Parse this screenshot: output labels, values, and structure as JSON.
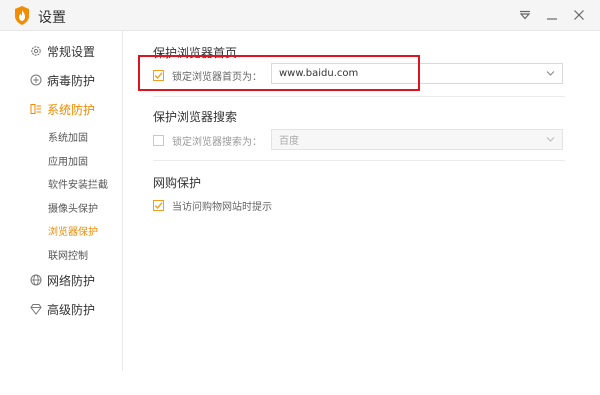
{
  "window": {
    "title": "设置",
    "icons": [
      "fire-shield-logo",
      "menu-dropdown-icon",
      "minimize-icon",
      "close-icon"
    ]
  },
  "sidebar": {
    "items": [
      {
        "label": "常规设置",
        "icon": "gear-icon"
      },
      {
        "label": "病毒防护",
        "icon": "plus-circle-icon"
      },
      {
        "label": "系统防护",
        "icon": "system-icon",
        "active": true
      },
      {
        "label": "网络防护",
        "icon": "globe-icon"
      },
      {
        "label": "高级防护",
        "icon": "diamond-icon"
      }
    ],
    "subitems": [
      {
        "label": "系统加固"
      },
      {
        "label": "应用加固"
      },
      {
        "label": "软件安装拦截"
      },
      {
        "label": "摄像头保护"
      },
      {
        "label": "浏览器保护",
        "active": true
      },
      {
        "label": "联网控制"
      }
    ]
  },
  "sections": {
    "homepage": {
      "title": "保护浏览器首页",
      "checkbox_label": "锁定浏览器首页为：",
      "checked": true,
      "value": "www.baidu.com"
    },
    "search": {
      "title": "保护浏览器搜索",
      "checkbox_label": "锁定浏览器搜索为：",
      "checked": false,
      "value": "百度"
    },
    "shopping": {
      "title": "网购保护",
      "checkbox_label": "当访问购物网站时提示",
      "checked": true
    }
  },
  "colors": {
    "accent": "#f08a00",
    "highlight": "#e0141e",
    "checkbox": "#f0a020"
  }
}
